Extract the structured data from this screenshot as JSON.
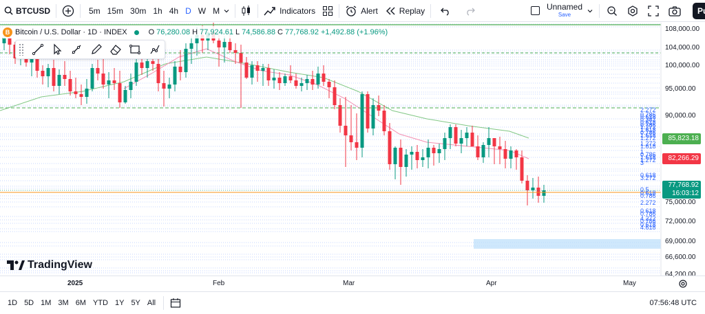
{
  "header": {
    "symbol": "BTCUSD",
    "intervals": [
      "5m",
      "15m",
      "30m",
      "1h",
      "4h",
      "D",
      "W",
      "M"
    ],
    "active_interval": "D",
    "indicators_label": "Indicators",
    "alert_label": "Alert",
    "replay_label": "Replay",
    "layout_name": "Unnamed",
    "save_label": "Save",
    "publish_label": "Pu"
  },
  "legend": {
    "coin_icon": "B",
    "title": "Bitcoin / U.S. Dollar · 1D · INDEX",
    "o_key": "O",
    "o_val": "76,280.08",
    "h_key": "H",
    "h_val": "77,924.61",
    "l_key": "L",
    "l_val": "74,586.88",
    "c_key": "C",
    "c_val": "77,768.92",
    "change": "+1,492.88 (+1.96%)"
  },
  "drawing_toolbar": [
    "trendline-icon",
    "cursor-icon",
    "ray-icon",
    "pencil-icon",
    "eraser-icon",
    "rectangle-icon",
    "path-icon"
  ],
  "price_axis": {
    "ticks": [
      "108,000.00",
      "104,000.00",
      "100,000.00",
      "95,000.00",
      "90,000.00",
      "75,000.00",
      "72,000.00",
      "69,000.00",
      "66,600.00",
      "64,200.00"
    ],
    "labels": {
      "ma_green": "85,823.18",
      "ma_red": "82,266.29",
      "last_price": "77,768.92",
      "countdown": "16:03:12"
    },
    "colors": {
      "green": "#4caf50",
      "red": "#f23645",
      "last": "#089981"
    }
  },
  "fib_labels": [
    "2.272",
    "0.786",
    "0.618",
    "0.382",
    "0.618",
    "0.786",
    "1.272",
    "1.618",
    "0.786",
    "1.618",
    "1.272",
    "1.272",
    "1.618",
    "1",
    "0.786",
    "1.618",
    "1.272",
    "3",
    "0.618",
    "3.272",
    "0.5",
    "0.618",
    "0.786",
    "2.272",
    "0.618",
    "0.786",
    "4.272",
    "0.786",
    "0.618",
    "4.618"
  ],
  "time_axis": {
    "labels": [
      "2025",
      "Feb",
      "Mar",
      "Apr",
      "May"
    ]
  },
  "brand": "TradingView",
  "bottom": {
    "ranges": [
      "1D",
      "5D",
      "1M",
      "3M",
      "6M",
      "YTD",
      "1Y",
      "5Y",
      "All"
    ],
    "time": "07:56:48 UTC"
  }
}
